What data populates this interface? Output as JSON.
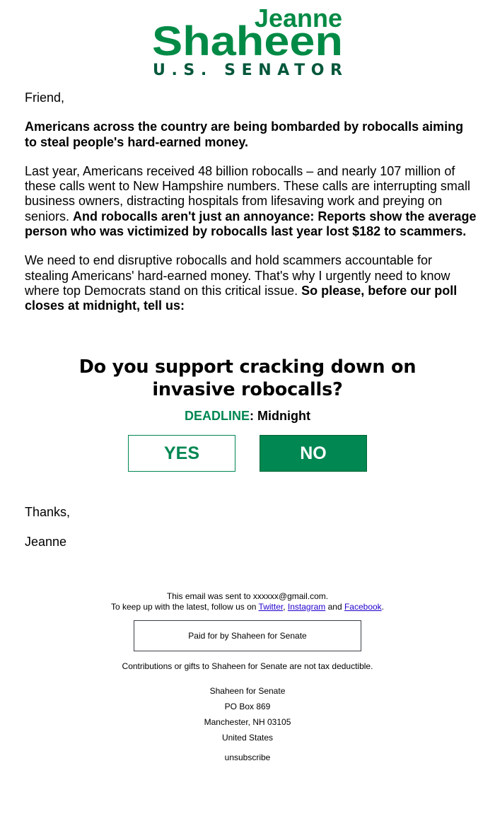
{
  "logo": {
    "first_name": "Jeanne",
    "last_name": "Shaheen",
    "title": "U.S. SENATOR",
    "colors": {
      "name": "#008a45",
      "title": "#00573a"
    }
  },
  "body": {
    "greeting": "Friend,",
    "intro_bold": "Americans across the country are being bombarded by robocalls aiming to steal people's hard-earned money.",
    "para2_regular": "Last year, Americans received 48 billion robocalls – and nearly 107 million of these calls went to New Hampshire numbers. These calls are interrupting small business owners, distracting hospitals from lifesaving work and preying on seniors. ",
    "para2_bold": "And robocalls aren't just an annoyance: Reports show the average person who was victimized by robocalls last year lost $182 to scammers.",
    "para3_regular": "We need to end disruptive robocalls and hold scammers accountable for stealing Americans' hard-earned money. That's why I urgently need to know where top Democrats stand on this critical issue. ",
    "para3_bold": "So please, before our poll closes at midnight, tell us:"
  },
  "poll": {
    "question_line1": "Do you support cracking down on",
    "question_line2": "invasive robocalls?",
    "deadline_label": "DEADLINE",
    "deadline_sep": ": ",
    "deadline_value": "Midnight",
    "yes_label": "YES",
    "no_label": "NO",
    "accent_color": "#008752"
  },
  "signoff": {
    "thanks": "Thanks,",
    "name": "Jeanne"
  },
  "footer": {
    "sent_to_prefix": "This email was sent to ",
    "email": "xxxxxx@gmail.com",
    "sent_to_suffix": ".",
    "follow_prefix": "To keep up with the latest, follow us on ",
    "links": {
      "twitter": "Twitter",
      "instagram": "Instagram",
      "facebook": "Facebook"
    },
    "comma": ", ",
    "and": " and ",
    "period": ".",
    "paid_for": "Paid for by Shaheen for Senate",
    "disclaimer": "Contributions or gifts to Shaheen for Senate are not tax deductible.",
    "address": {
      "org": "Shaheen for Senate",
      "po_box": "PO Box 869",
      "city": "Manchester, NH 03105",
      "country": "United States"
    },
    "unsubscribe": "unsubscribe"
  }
}
